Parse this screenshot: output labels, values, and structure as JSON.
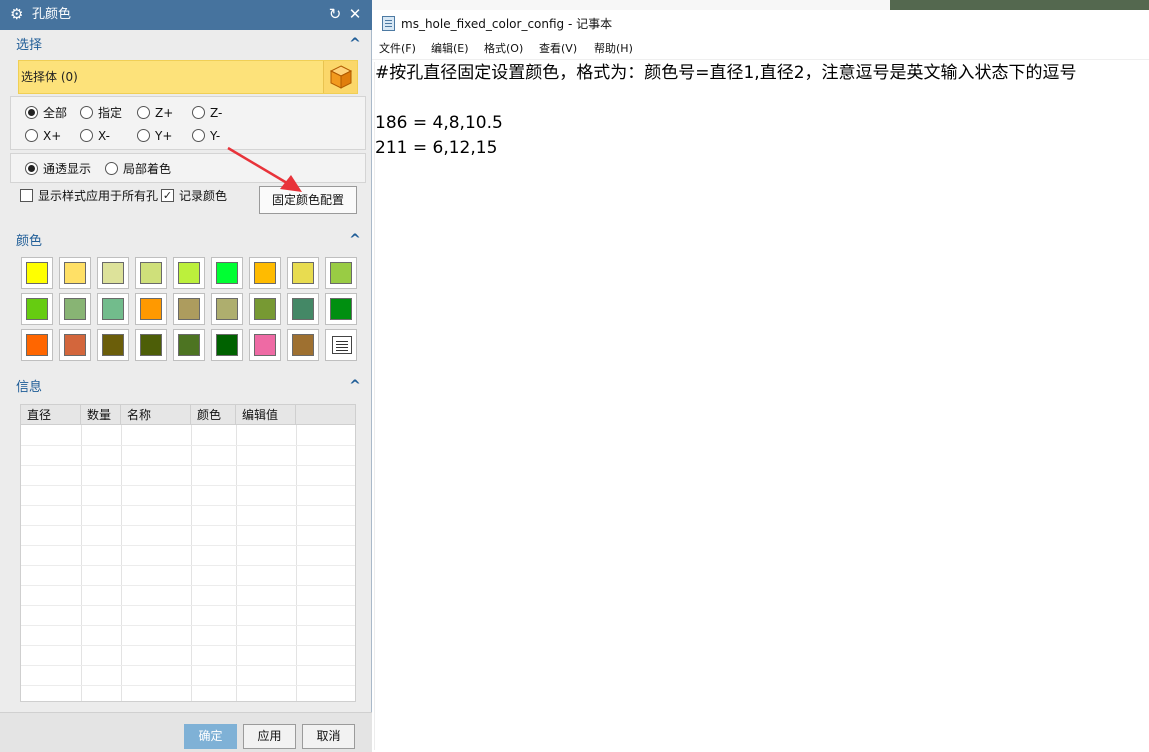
{
  "dialog": {
    "title": "孔颜色",
    "selection": {
      "header": "选择",
      "select_body": "选择体 (0)",
      "direction_options": [
        {
          "label": "全部",
          "checked": true
        },
        {
          "label": "指定",
          "checked": false
        },
        {
          "label": "Z+",
          "checked": false
        },
        {
          "label": "Z-",
          "checked": false
        },
        {
          "label": "X+",
          "checked": false
        },
        {
          "label": "X-",
          "checked": false
        },
        {
          "label": "Y+",
          "checked": false
        },
        {
          "label": "Y-",
          "checked": false
        }
      ],
      "display_options": [
        {
          "label": "通透显示",
          "checked": true
        },
        {
          "label": "局部着色",
          "checked": false
        }
      ],
      "apply_style_all": {
        "label": "显示样式应用于所有孔",
        "checked": false
      },
      "record_color": {
        "label": "记录颜色",
        "checked": true
      },
      "fixed_config_button": "固定颜色配置"
    },
    "colors": {
      "header": "颜色",
      "swatches": [
        "#ffff00",
        "#ffe066",
        "#dde29a",
        "#cfe07a",
        "#bcf03c",
        "#00ff33",
        "#ffbb00",
        "#e8dc50",
        "#99cc44",
        "#66cc11",
        "#88b474",
        "#72bc8c",
        "#ff9900",
        "#ad9c5e",
        "#aeae6e",
        "#779933",
        "#448866",
        "#008f10",
        "#ff6600",
        "#d3663c",
        "#6b5e0a",
        "#4d5e08",
        "#4d7422",
        "#006200",
        "#ee6aa4",
        "#9e7030"
      ],
      "custom_icon": "custom-color-icon"
    },
    "info": {
      "header": "信息",
      "columns": [
        "直径",
        "数量",
        "名称",
        "颜色",
        "编辑值"
      ],
      "rows": []
    },
    "buttons": {
      "ok": "确定",
      "apply": "应用",
      "cancel": "取消"
    }
  },
  "notepad": {
    "title": "ms_hole_fixed_color_config - 记事本",
    "menu": [
      "文件(F)",
      "编辑(E)",
      "格式(O)",
      "查看(V)",
      "帮助(H)"
    ],
    "lines": [
      "#按孔直径固定设置颜色，格式为：颜色号=直径1,直径2，注意逗号是英文输入状态下的逗号",
      "",
      "186 = 4,8,10.5",
      "211 = 6,12,15"
    ]
  }
}
